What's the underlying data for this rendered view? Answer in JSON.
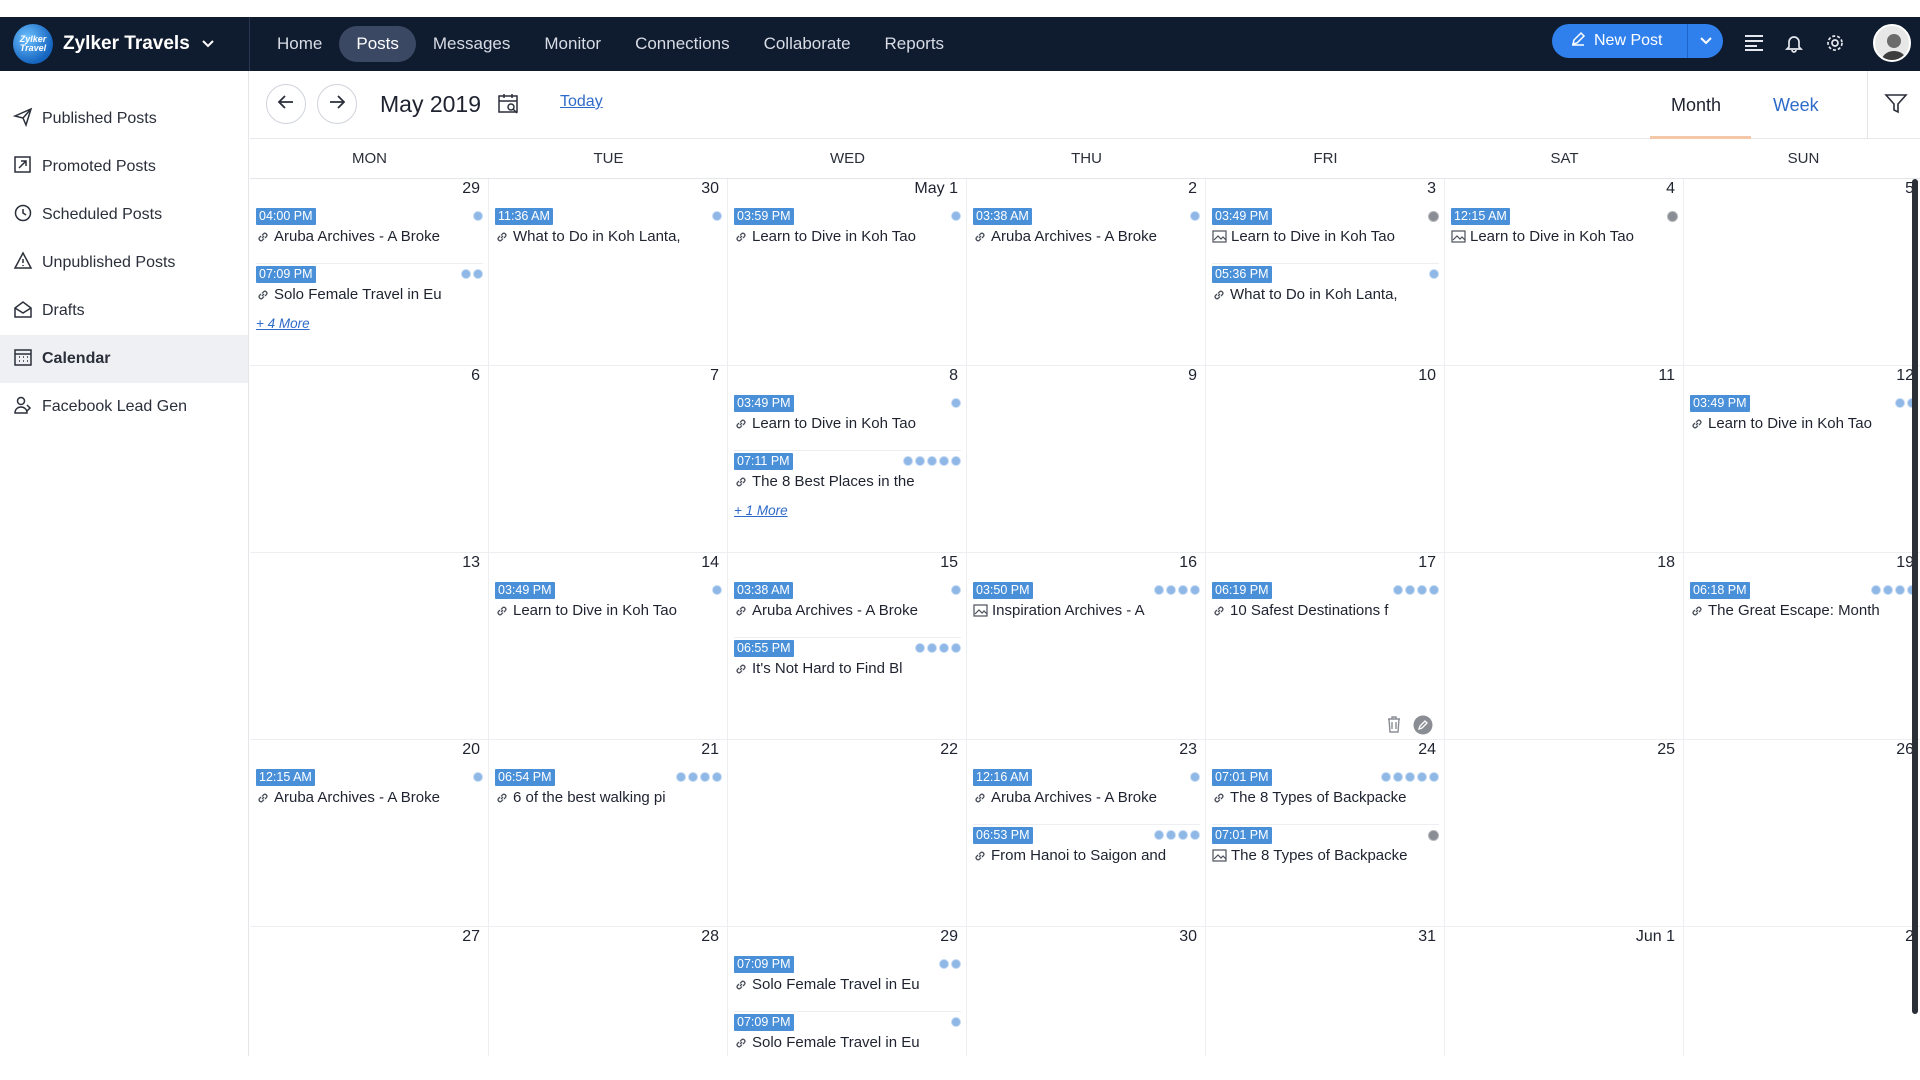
{
  "app": {
    "brand_logo_text": "Zylker Travel",
    "brand_name": "Zylker Travels"
  },
  "nav": {
    "items": [
      "Home",
      "Posts",
      "Messages",
      "Monitor",
      "Connections",
      "Collaborate",
      "Reports"
    ],
    "active": "Posts"
  },
  "header": {
    "new_post_label": "New Post"
  },
  "sidebar": {
    "items": [
      "Published Posts",
      "Promoted Posts",
      "Scheduled Posts",
      "Unpublished Posts",
      "Drafts",
      "Calendar",
      "Facebook Lead Gen"
    ],
    "active": "Calendar"
  },
  "calendar": {
    "month_label": "May 2019",
    "today_label": "Today",
    "view_tabs": {
      "month": "Month",
      "week": "Week"
    },
    "active_view": "Month",
    "days_of_week": [
      "MON",
      "TUE",
      "WED",
      "THU",
      "FRI",
      "SAT",
      "SUN"
    ],
    "weeks": [
      [
        {
          "day": "29",
          "events": [
            {
              "time": "04:00 PM",
              "title": "Aruba Archives - A Broke",
              "icon": "link",
              "social": [
                "blue"
              ]
            },
            {
              "time": "07:09 PM",
              "title": "Solo Female Travel in Eu",
              "icon": "link",
              "social": [
                "blue",
                "blue"
              ]
            }
          ],
          "more": "+ 4 More"
        },
        {
          "day": "30",
          "events": [
            {
              "time": "11:36 AM",
              "title": "What to Do in Koh Lanta,",
              "icon": "link",
              "social": [
                "blue"
              ]
            }
          ]
        },
        {
          "day": "May 1",
          "events": [
            {
              "time": "03:59 PM",
              "title": "Learn to Dive in Koh Tao",
              "icon": "link",
              "social": [
                "blue"
              ]
            }
          ]
        },
        {
          "day": "2",
          "events": [
            {
              "time": "03:38 AM",
              "title": "Aruba Archives - A Broke",
              "icon": "link",
              "social": [
                "blue"
              ]
            }
          ]
        },
        {
          "day": "3",
          "events": [
            {
              "time": "03:49 PM",
              "title": "Learn to Dive in Koh Tao",
              "icon": "image",
              "social": [
                "gray"
              ]
            },
            {
              "time": "05:36 PM",
              "title": "What to Do in Koh Lanta,",
              "icon": "link",
              "social": [
                "blue"
              ]
            }
          ]
        },
        {
          "day": "4",
          "events": [
            {
              "time": "12:15 AM",
              "title": "Learn to Dive in Koh Tao",
              "icon": "image",
              "social": [
                "gray"
              ]
            }
          ]
        },
        {
          "day": "5",
          "events": []
        }
      ],
      [
        {
          "day": "6",
          "events": []
        },
        {
          "day": "7",
          "events": []
        },
        {
          "day": "8",
          "events": [
            {
              "time": "03:49 PM",
              "title": "Learn to Dive in Koh Tao",
              "icon": "link",
              "social": [
                "blue"
              ]
            },
            {
              "time": "07:11 PM",
              "title": "The 8 Best Places in the",
              "icon": "link",
              "social": [
                "blue",
                "blue",
                "blue",
                "blue",
                "blue"
              ]
            }
          ],
          "more": "+ 1 More"
        },
        {
          "day": "9",
          "events": []
        },
        {
          "day": "10",
          "events": []
        },
        {
          "day": "11",
          "events": []
        },
        {
          "day": "12",
          "events": [
            {
              "time": "03:49 PM",
              "title": "Learn to Dive in Koh Tao",
              "icon": "link",
              "social": [
                "blue",
                "blue"
              ]
            }
          ]
        }
      ],
      [
        {
          "day": "13",
          "events": []
        },
        {
          "day": "14",
          "events": [
            {
              "time": "03:49 PM",
              "title": "Learn to Dive in Koh Tao",
              "icon": "link",
              "social": [
                "blue"
              ]
            }
          ]
        },
        {
          "day": "15",
          "events": [
            {
              "time": "03:38 AM",
              "title": "Aruba Archives - A Broke",
              "icon": "link",
              "social": [
                "blue"
              ]
            },
            {
              "time": "06:55 PM",
              "title": "It's Not Hard to Find Bl",
              "icon": "link",
              "social": [
                "blue",
                "blue",
                "blue",
                "blue"
              ]
            }
          ]
        },
        {
          "day": "16",
          "events": [
            {
              "time": "03:50 PM",
              "title": "Inspiration Archives - A",
              "icon": "image",
              "social": [
                "blue",
                "blue",
                "blue",
                "blue"
              ]
            }
          ]
        },
        {
          "day": "17",
          "events": [
            {
              "time": "06:19 PM",
              "title": "10 Safest Destinations f",
              "icon": "link",
              "social": [
                "blue",
                "blue",
                "blue",
                "blue"
              ]
            }
          ],
          "actions": true
        },
        {
          "day": "18",
          "events": []
        },
        {
          "day": "19",
          "events": [
            {
              "time": "06:18 PM",
              "title": "The Great Escape: Month",
              "icon": "link",
              "social": [
                "blue",
                "blue",
                "blue",
                "blue"
              ]
            }
          ]
        }
      ],
      [
        {
          "day": "20",
          "events": [
            {
              "time": "12:15 AM",
              "title": "Aruba Archives - A Broke",
              "icon": "link",
              "social": [
                "blue"
              ]
            }
          ]
        },
        {
          "day": "21",
          "events": [
            {
              "time": "06:54 PM",
              "title": "6 of the best walking pi",
              "icon": "link",
              "social": [
                "blue",
                "blue",
                "blue",
                "blue"
              ]
            }
          ]
        },
        {
          "day": "22",
          "events": []
        },
        {
          "day": "23",
          "events": [
            {
              "time": "12:16 AM",
              "title": "Aruba Archives - A Broke",
              "icon": "link",
              "social": [
                "blue"
              ]
            },
            {
              "time": "06:53 PM",
              "title": "From Hanoi to Saigon and",
              "icon": "link",
              "social": [
                "blue",
                "blue",
                "blue",
                "blue"
              ]
            }
          ]
        },
        {
          "day": "24",
          "events": [
            {
              "time": "07:01 PM",
              "title": "The 8 Types of Backpacke",
              "icon": "link",
              "social": [
                "blue",
                "blue",
                "blue",
                "blue",
                "blue"
              ]
            },
            {
              "time": "07:01 PM",
              "title": "The 8 Types of Backpacke",
              "icon": "image",
              "social": [
                "gray"
              ]
            }
          ]
        },
        {
          "day": "25",
          "events": []
        },
        {
          "day": "26",
          "events": []
        }
      ],
      [
        {
          "day": "27",
          "events": []
        },
        {
          "day": "28",
          "events": []
        },
        {
          "day": "29",
          "events": [
            {
              "time": "07:09 PM",
              "title": "Solo Female Travel in Eu",
              "icon": "link",
              "social": [
                "blue",
                "blue"
              ]
            },
            {
              "time": "07:09 PM",
              "title": "Solo Female Travel in Eu",
              "icon": "link",
              "social": [
                "blue"
              ]
            }
          ]
        },
        {
          "day": "30",
          "events": []
        },
        {
          "day": "31",
          "events": []
        },
        {
          "day": "Jun 1",
          "events": []
        },
        {
          "day": "2",
          "events": []
        }
      ]
    ]
  },
  "colors": {
    "topbar": "#0f1b2e",
    "accent": "#2f80ed",
    "time_badge": "#4a90d9",
    "link": "#2f6bc8"
  }
}
